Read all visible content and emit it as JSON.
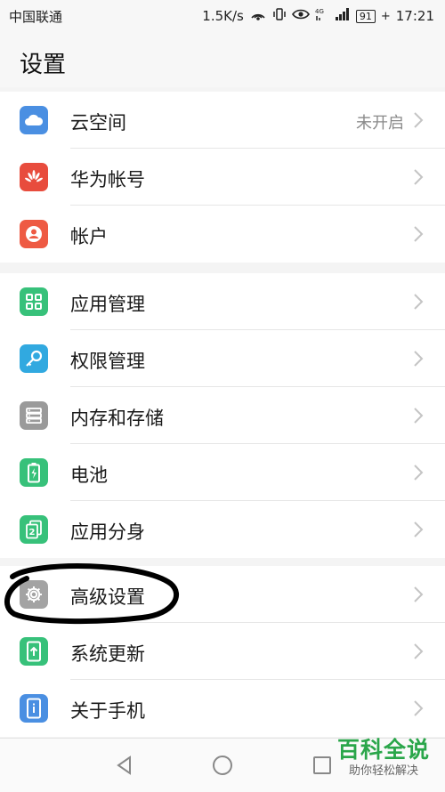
{
  "status_bar": {
    "carrier": "中国联通",
    "speed": "1.5K/s",
    "battery": "91",
    "time": "17:21",
    "icons": [
      "hotspot-icon",
      "vibrate-icon",
      "eye-icon",
      "4g-signal-icon",
      "signal-bars-icon"
    ]
  },
  "header": {
    "title": "设置"
  },
  "groups": [
    {
      "items": [
        {
          "label": "云空间",
          "value": "未开启",
          "icon": "cloud-icon",
          "color": "#4a8fe2"
        },
        {
          "label": "华为帐号",
          "icon": "huawei-logo-icon",
          "color": "#e84c3d"
        },
        {
          "label": "帐户",
          "icon": "user-icon",
          "color": "#ee5a43"
        }
      ]
    },
    {
      "items": [
        {
          "label": "应用管理",
          "icon": "grid-icon",
          "color": "#37c17a"
        },
        {
          "label": "权限管理",
          "icon": "key-icon",
          "color": "#31a9e0"
        },
        {
          "label": "内存和存储",
          "icon": "storage-icon",
          "color": "#9a9a9a"
        },
        {
          "label": "电池",
          "icon": "battery-icon",
          "color": "#37c17a"
        },
        {
          "label": "应用分身",
          "icon": "app-twin-icon",
          "color": "#37c17a"
        }
      ]
    },
    {
      "items": [
        {
          "label": "高级设置",
          "icon": "gear-icon",
          "color": "#a3a3a3"
        },
        {
          "label": "系统更新",
          "icon": "system-update-icon",
          "color": "#37c17a"
        },
        {
          "label": "关于手机",
          "icon": "phone-info-icon",
          "color": "#4a8fe2"
        }
      ]
    }
  ],
  "nav_bar": {
    "icons": [
      "back-icon",
      "home-icon",
      "recents-icon"
    ]
  },
  "watermark": {
    "main": "百科全说",
    "sub": "助你轻松解决"
  }
}
